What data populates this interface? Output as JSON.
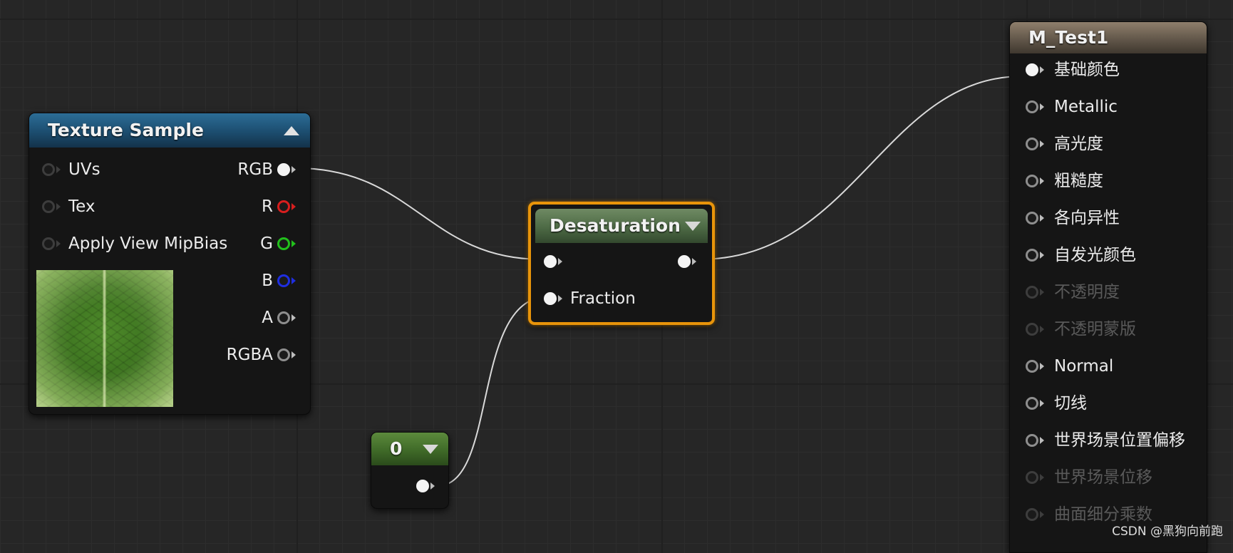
{
  "colors": {
    "background": "#262626",
    "wire": "#d9d9d9",
    "selected_outline": "#e8940a",
    "pin_red": "#d71e1e",
    "pin_green": "#22c01c",
    "pin_blue": "#1f2ee0"
  },
  "texture_sample": {
    "title": "Texture Sample",
    "inputs": [
      "UVs",
      "Tex",
      "Apply View MipBias"
    ],
    "outputs": [
      "RGB",
      "R",
      "G",
      "B",
      "A",
      "RGBA"
    ],
    "preview_icon": "leaf-texture"
  },
  "desaturation": {
    "title": "Desaturation",
    "fraction_label": "Fraction"
  },
  "constant": {
    "title": "0"
  },
  "material": {
    "title": "M_Test1",
    "pins": [
      {
        "label": "基础颜色"
      },
      {
        "label": "Metallic"
      },
      {
        "label": "高光度"
      },
      {
        "label": "粗糙度"
      },
      {
        "label": "各向异性"
      },
      {
        "label": "自发光颜色"
      },
      {
        "label": "不透明度"
      },
      {
        "label": "不透明蒙版"
      },
      {
        "label": "Normal"
      },
      {
        "label": "切线"
      },
      {
        "label": "世界场景位置偏移"
      },
      {
        "label": "世界场景位移"
      },
      {
        "label": "曲面细分乘数"
      }
    ]
  },
  "watermark": "CSDN @黑狗向前跑"
}
